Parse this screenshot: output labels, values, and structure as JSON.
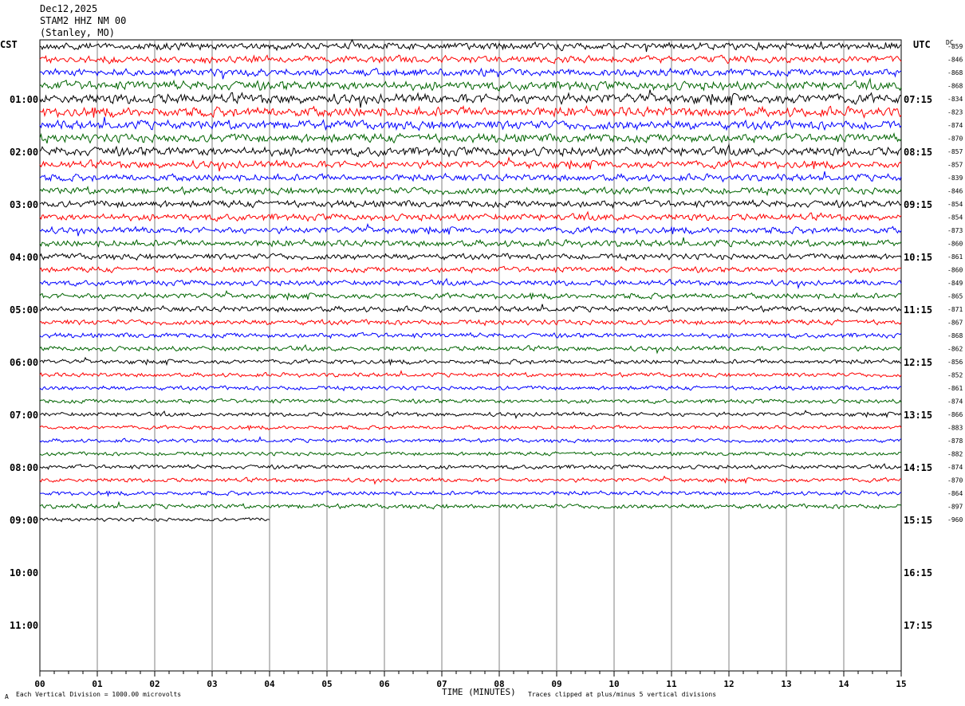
{
  "header": {
    "date": "Dec12,2025",
    "station": "STAM2 HHZ NM 00",
    "location": "(Stanley, MO)"
  },
  "left_tz": "CST",
  "right_tz": "UTC",
  "dc_header": "DC",
  "footer": {
    "scale_note": "Each Vertical Division = 1000.00 microvolts",
    "clip_note": "Traces clipped at plus/minus 5 vertical divisions",
    "corner_mark": "A"
  },
  "chart_data": {
    "type": "line",
    "title": "",
    "xlabel": "TIME (MINUTES)",
    "ylabel": "",
    "xlim": [
      0,
      15
    ],
    "x_ticks": [
      "00",
      "01",
      "02",
      "03",
      "04",
      "05",
      "06",
      "07",
      "08",
      "09",
      "10",
      "11",
      "12",
      "13",
      "14",
      "15"
    ],
    "left_time_labels": [
      "01:00",
      "02:00",
      "03:00",
      "04:00",
      "05:00",
      "06:00",
      "07:00",
      "08:00",
      "09:00",
      "10:00",
      "11:00"
    ],
    "right_time_labels": [
      "07:15",
      "08:15",
      "09:15",
      "10:15",
      "11:15",
      "12:15",
      "13:15",
      "14:15",
      "15:15",
      "16:15",
      "17:15"
    ],
    "trace_colors": [
      "#000000",
      "#ff0000",
      "#0000ff",
      "#006400"
    ],
    "rows_per_label": 4,
    "dc_offsets": [
      "-859",
      "-846",
      "-868",
      "-868",
      "-834",
      "-823",
      "-874",
      "-870",
      "-857",
      "-857",
      "-839",
      "-846",
      "-854",
      "-854",
      "-873",
      "-860",
      "-861",
      "-860",
      "-849",
      "-865",
      "-871",
      "-867",
      "-868",
      "-862",
      "-856",
      "-852",
      "-861",
      "-874",
      "-866",
      "-883",
      "-878",
      "-882",
      "-874",
      "-870",
      "-864",
      "-897",
      "-960"
    ],
    "full_traces": 36,
    "last_trace_minutes": 4.0,
    "trace_amplitude_relative": [
      1.0,
      1.0,
      1.05,
      1.3,
      1.45,
      1.4,
      1.3,
      1.25,
      1.3,
      1.1,
      1.0,
      1.0,
      1.0,
      1.0,
      0.95,
      0.95,
      0.85,
      0.8,
      0.8,
      0.8,
      0.8,
      0.75,
      0.7,
      0.7,
      0.65,
      0.6,
      0.6,
      0.6,
      0.6,
      0.55,
      0.55,
      0.55,
      0.6,
      0.6,
      0.6,
      0.65,
      0.5
    ]
  }
}
